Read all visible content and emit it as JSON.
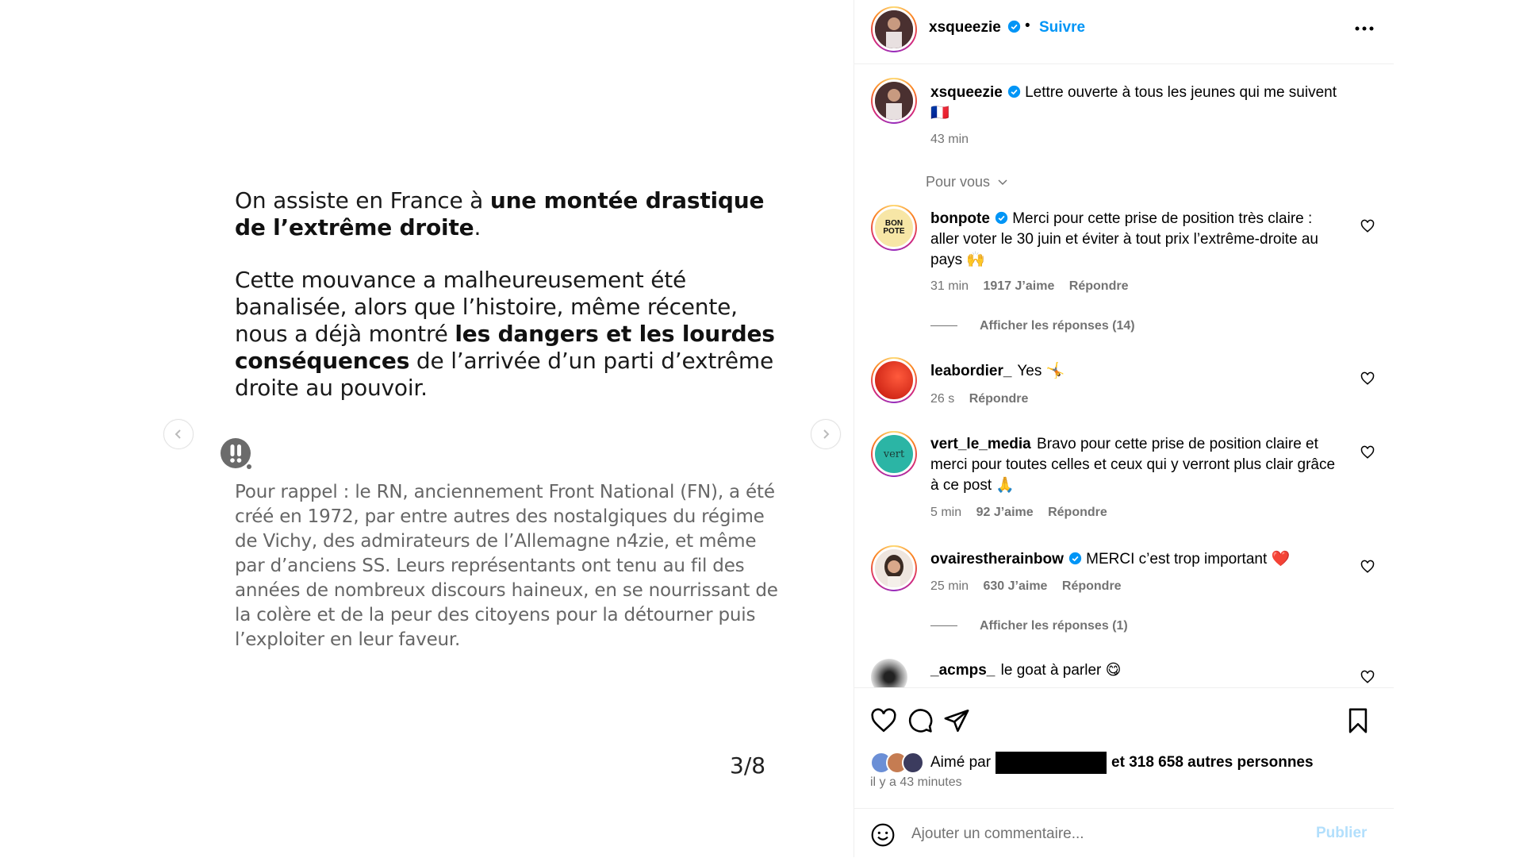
{
  "slide": {
    "p1_normal": "On assiste en France à ",
    "p1_bold": "une montée drastique de l’extrême droite",
    "p1_end": ".",
    "p2_normal": "Cette mouvance a malheureusement été banalisée, alors que l’histoire, même récente, nous a déjà montré ",
    "p2_bold": "les dangers et les lourdes conséquences",
    "p2_end": " de l’arrivée d’un parti d’extrême droite au pouvoir.",
    "p3": "Pour rappel : le RN, anciennement Front National (FN), a été créé en 1972, par entre autres des nostalgiques du régime de Vichy, des admirateurs de l’Allemagne n4zie, et même par d’anciens SS. Leurs représentants ont tenu au fil des années de nombreux discours haineux, en se nourrissant de la colère et de la peur des citoyens pour la détourner puis l’exploiter en leur faveur.",
    "page_counter": "3/8"
  },
  "header": {
    "username": "xsqueezie",
    "dot": "•",
    "follow_label": "Suivre"
  },
  "caption": {
    "username": "xsqueezie",
    "text": "Lettre ouverte à tous les jeunes qui me suivent 🇫🇷",
    "time": "43 min"
  },
  "sort_label": "Pour vous",
  "comments": [
    {
      "username": "bonpote",
      "verified": true,
      "text": "Merci pour cette prise de position très claire : aller voter le 30 juin et éviter à tout prix l’extrême-droite au pays 🙌",
      "time": "31 min",
      "likes": "1917 J’aime",
      "reply": "Répondre",
      "replies_label": "Afficher les réponses (14)",
      "avatar_text": "BON POTE"
    },
    {
      "username": "leabordier_",
      "verified": false,
      "text": "Yes 🤸",
      "time": "26 s",
      "reply": "Répondre"
    },
    {
      "username": "vert_le_media",
      "verified": false,
      "text": "Bravo pour cette prise de position claire et merci pour toutes celles et ceux qui y verront plus clair grâce à ce post 🙏",
      "time": "5 min",
      "likes": "92 J’aime",
      "reply": "Répondre",
      "avatar_text": "vert"
    },
    {
      "username": "ovairestherainbow",
      "verified": true,
      "text": "MERCI c’est trop important ❤️",
      "time": "25 min",
      "likes": "630 J’aime",
      "reply": "Répondre",
      "replies_label": "Afficher les réponses (1)"
    },
    {
      "username": "_acmps_",
      "verified": false,
      "text": "le goat à parler 😋"
    }
  ],
  "likes": {
    "prefix": "Aimé par",
    "suffix": "et 318 658 autres personnes",
    "time_ago": "il y a 43 minutes"
  },
  "comment_box": {
    "placeholder": "Ajouter un commentaire...",
    "publish_label": "Publier"
  },
  "colors": {
    "accent": "#0095f6",
    "secondary_text": "#737373",
    "publish_disabled": "#b2dffc"
  }
}
